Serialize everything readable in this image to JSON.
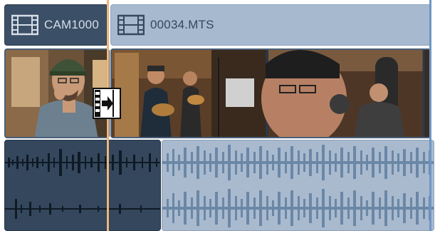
{
  "timeline": {
    "clips": [
      {
        "name": "CAM1000",
        "icon": "film-strip-icon"
      },
      {
        "name": "00034.MTS",
        "icon": "film-strip-icon"
      }
    ],
    "cursor_icon": "ripple-trim-cursor-icon",
    "colors": {
      "selected_clip": "#3b4f66",
      "unselected_clip": "#a7b9cf",
      "playhead": "#e8a25a",
      "waveform_selected": "#0f1a26",
      "waveform_unselected": "#6b87a6"
    }
  }
}
